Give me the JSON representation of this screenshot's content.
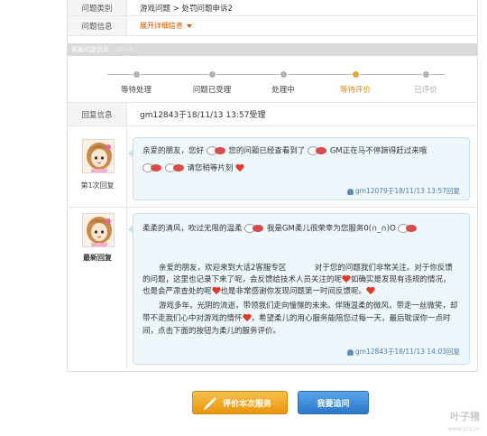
{
  "info": {
    "category_label": "问题类别",
    "category_value": "游戏问题 > 处罚问题申诉2",
    "problem_label": "问题信息",
    "expand_label": "展开详细信息"
  },
  "section": {
    "title": "客服回复信息",
    "count": "（共2条）"
  },
  "progress": {
    "steps": [
      {
        "label": "等待处理"
      },
      {
        "label": "问题已受理"
      },
      {
        "label": "处理中"
      },
      {
        "label": "等待评价"
      },
      {
        "label": "已评价"
      }
    ],
    "active_index": 3
  },
  "reply_info": {
    "label": "回复信息",
    "value": "gm12843于18/11/13 13:57受理"
  },
  "messages": [
    {
      "who": "第1次回复",
      "line1_a": "亲爱的朋友，您好",
      "line1_b": "您的问题已经查看到了",
      "line1_c": "GM正在马不停蹄得赶过来哦",
      "line2": "请您稍等片刻",
      "signature": "gm12079于18/11/13 13:57回复"
    },
    {
      "who": "最新回复",
      "line1_a": "柔柔的清风，吹过无限的温柔",
      "line1_b": "我是GM柔儿很荣幸为您服务0(∩_∩)O",
      "para1_l1": "亲爱的朋友，欢迎来到大话2客服专区",
      "para1_l1b": "对于您的问题我们非常关注。对于你反馈",
      "para1_l2": "的问题，这里也记录下来了呢，会反馈给技术人员关注的呢",
      "para1_l2b": "如确实是发现有违规的情况，",
      "para1_l3": "也是会严肃查处的呢",
      "para1_l3b": "也是非常感谢你发现问题第一时间反馈呢。",
      "para2_l1": "游戏多年，光阴的流逝，带领我们走向憧憬的未来。伴随温柔的微风，带走一丝微笑，却",
      "para2_l2": "带不走我们心中对游戏的情怀",
      "para2_l2b": "，希望柔儿的用心服务能陪您过每一天，最后耽误你一点时",
      "para2_l3": "间，点击下面的按钮为柔儿的服务评价。",
      "signature": "gm12843于18/11/13 14:03回复"
    }
  ],
  "buttons": {
    "rate": "评价本次服务",
    "ask": "我要追问"
  },
  "watermark": {
    "main": "叶子猪",
    "sub": "www.yzz.cn"
  },
  "colors": {
    "accent_orange": "#e8940c",
    "accent_blue": "#2b76c9",
    "bubble_bg": "#eef7fc",
    "heart": "#e03b2a"
  }
}
